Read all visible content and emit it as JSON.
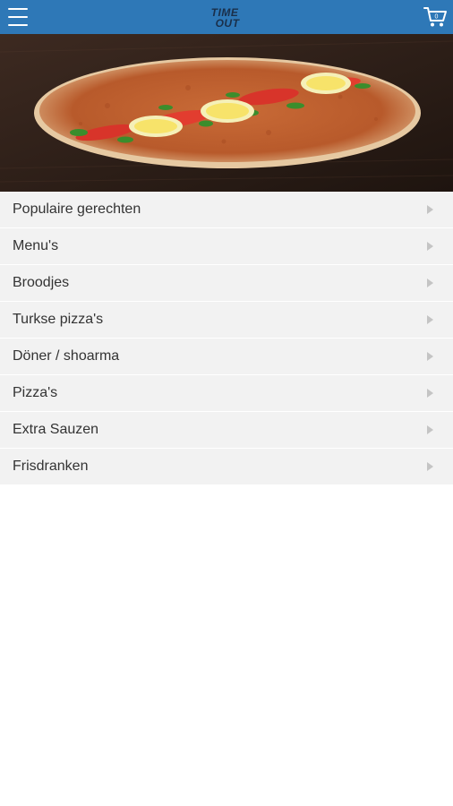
{
  "header": {
    "logo_line1": "TIME",
    "logo_line2": "OUT",
    "menu_icon": "hamburger-menu-icon",
    "cart_icon": "shopping-cart-icon",
    "bar_color": "#2e78b7"
  },
  "hero": {
    "image": "turkish-pizza-lahmacun-photo"
  },
  "categories": [
    {
      "label": "Populaire gerechten"
    },
    {
      "label": "Menu's"
    },
    {
      "label": "Broodjes"
    },
    {
      "label": "Turkse pizza's"
    },
    {
      "label": "Döner / shoarma"
    },
    {
      "label": "Pizza's"
    },
    {
      "label": "Extra Sauzen"
    },
    {
      "label": "Frisdranken"
    }
  ]
}
